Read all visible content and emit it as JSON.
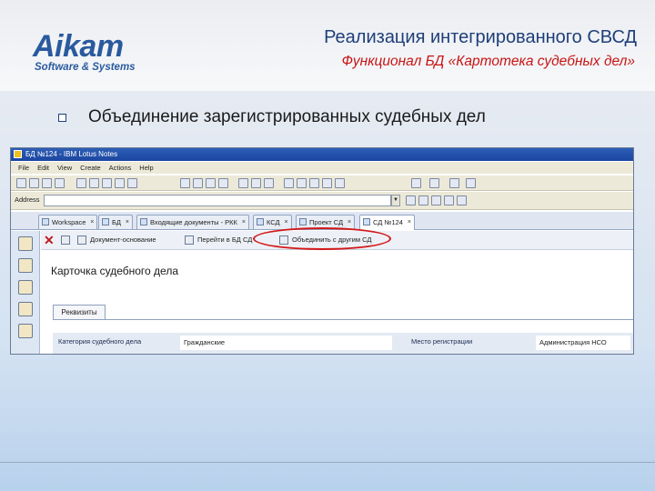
{
  "logo": {
    "name": "Aikam",
    "tagline": "Software & Systems"
  },
  "slide": {
    "title": "Реализация интегрированного СВСД",
    "subtitle": "Функционал БД «Картотека судебных дел»",
    "bullet": "Объединение зарегистрированных судебных дел"
  },
  "window": {
    "title": "БД №124 - IBM Lotus Notes",
    "menu": [
      "File",
      "Edit",
      "View",
      "Create",
      "Actions",
      "Help"
    ],
    "address_label": "Address",
    "address_value": "",
    "tabs": [
      {
        "label": "Workspace",
        "active": false
      },
      {
        "label": "БД",
        "active": false
      },
      {
        "label": "Входящие документы - РКК",
        "active": false
      },
      {
        "label": "КСД",
        "active": false
      },
      {
        "label": "Проект СД",
        "active": false
      },
      {
        "label": "СД №124",
        "active": true
      }
    ],
    "actions": [
      {
        "label": "Документ-основание"
      },
      {
        "label": "Перейти в БД СД"
      },
      {
        "label": "Объединить с другим СД"
      }
    ],
    "card_title": "Карточка судебного дела",
    "subtab": "Реквизиты",
    "fields": [
      {
        "label": "Категория судебного дела",
        "value": "Гражданские"
      },
      {
        "label": "Место регистрации",
        "value": "Администрация НСО"
      }
    ]
  },
  "colors": {
    "title_blue": "#1f3f7a",
    "subtitle_red": "#c81414",
    "highlight_red": "#d4181a",
    "logo_blue": "#2a5a9e"
  }
}
